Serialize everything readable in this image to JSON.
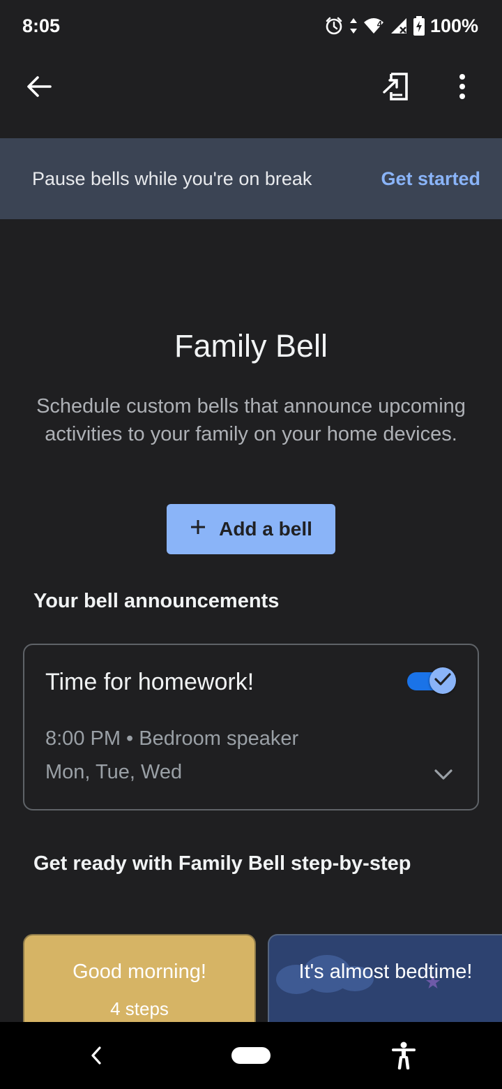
{
  "status_bar": {
    "time": "8:05",
    "battery_percent": "100%",
    "network_badge": "4",
    "icons": [
      "alarm-icon",
      "data-arrows-icon",
      "wifi-icon",
      "cell-signal-icon",
      "battery-charging-icon"
    ]
  },
  "app_bar": {
    "icons": [
      "back-arrow-icon",
      "open-in-device-icon",
      "more-vert-icon"
    ]
  },
  "banner": {
    "text": "Pause bells while you're on break",
    "cta": "Get started"
  },
  "hero": {
    "title": "Family Bell",
    "description": "Schedule custom bells that announce upcoming activities to your family on your home devices."
  },
  "add_button": {
    "icon": "plus-icon",
    "label": "Add a bell"
  },
  "announcements": {
    "section_title": "Your bell announcements",
    "bells": [
      {
        "name": "Time for homework!",
        "meta": "8:00 PM • Bedroom speaker",
        "days": "Mon, Tue, Wed",
        "enabled": true
      }
    ]
  },
  "steps": {
    "section_title": "Get ready with Family Bell step-by-step",
    "cards": [
      {
        "title": "Good morning!",
        "subtitle": "4 steps",
        "color": "#d6b465"
      },
      {
        "title": "It's almost bedtime!",
        "color": "#2d4270"
      }
    ]
  },
  "colors": {
    "accent": "#8ab4f8",
    "background": "#1f1f21",
    "banner": "#3b4454",
    "toggle_on": "#1a73e8"
  }
}
